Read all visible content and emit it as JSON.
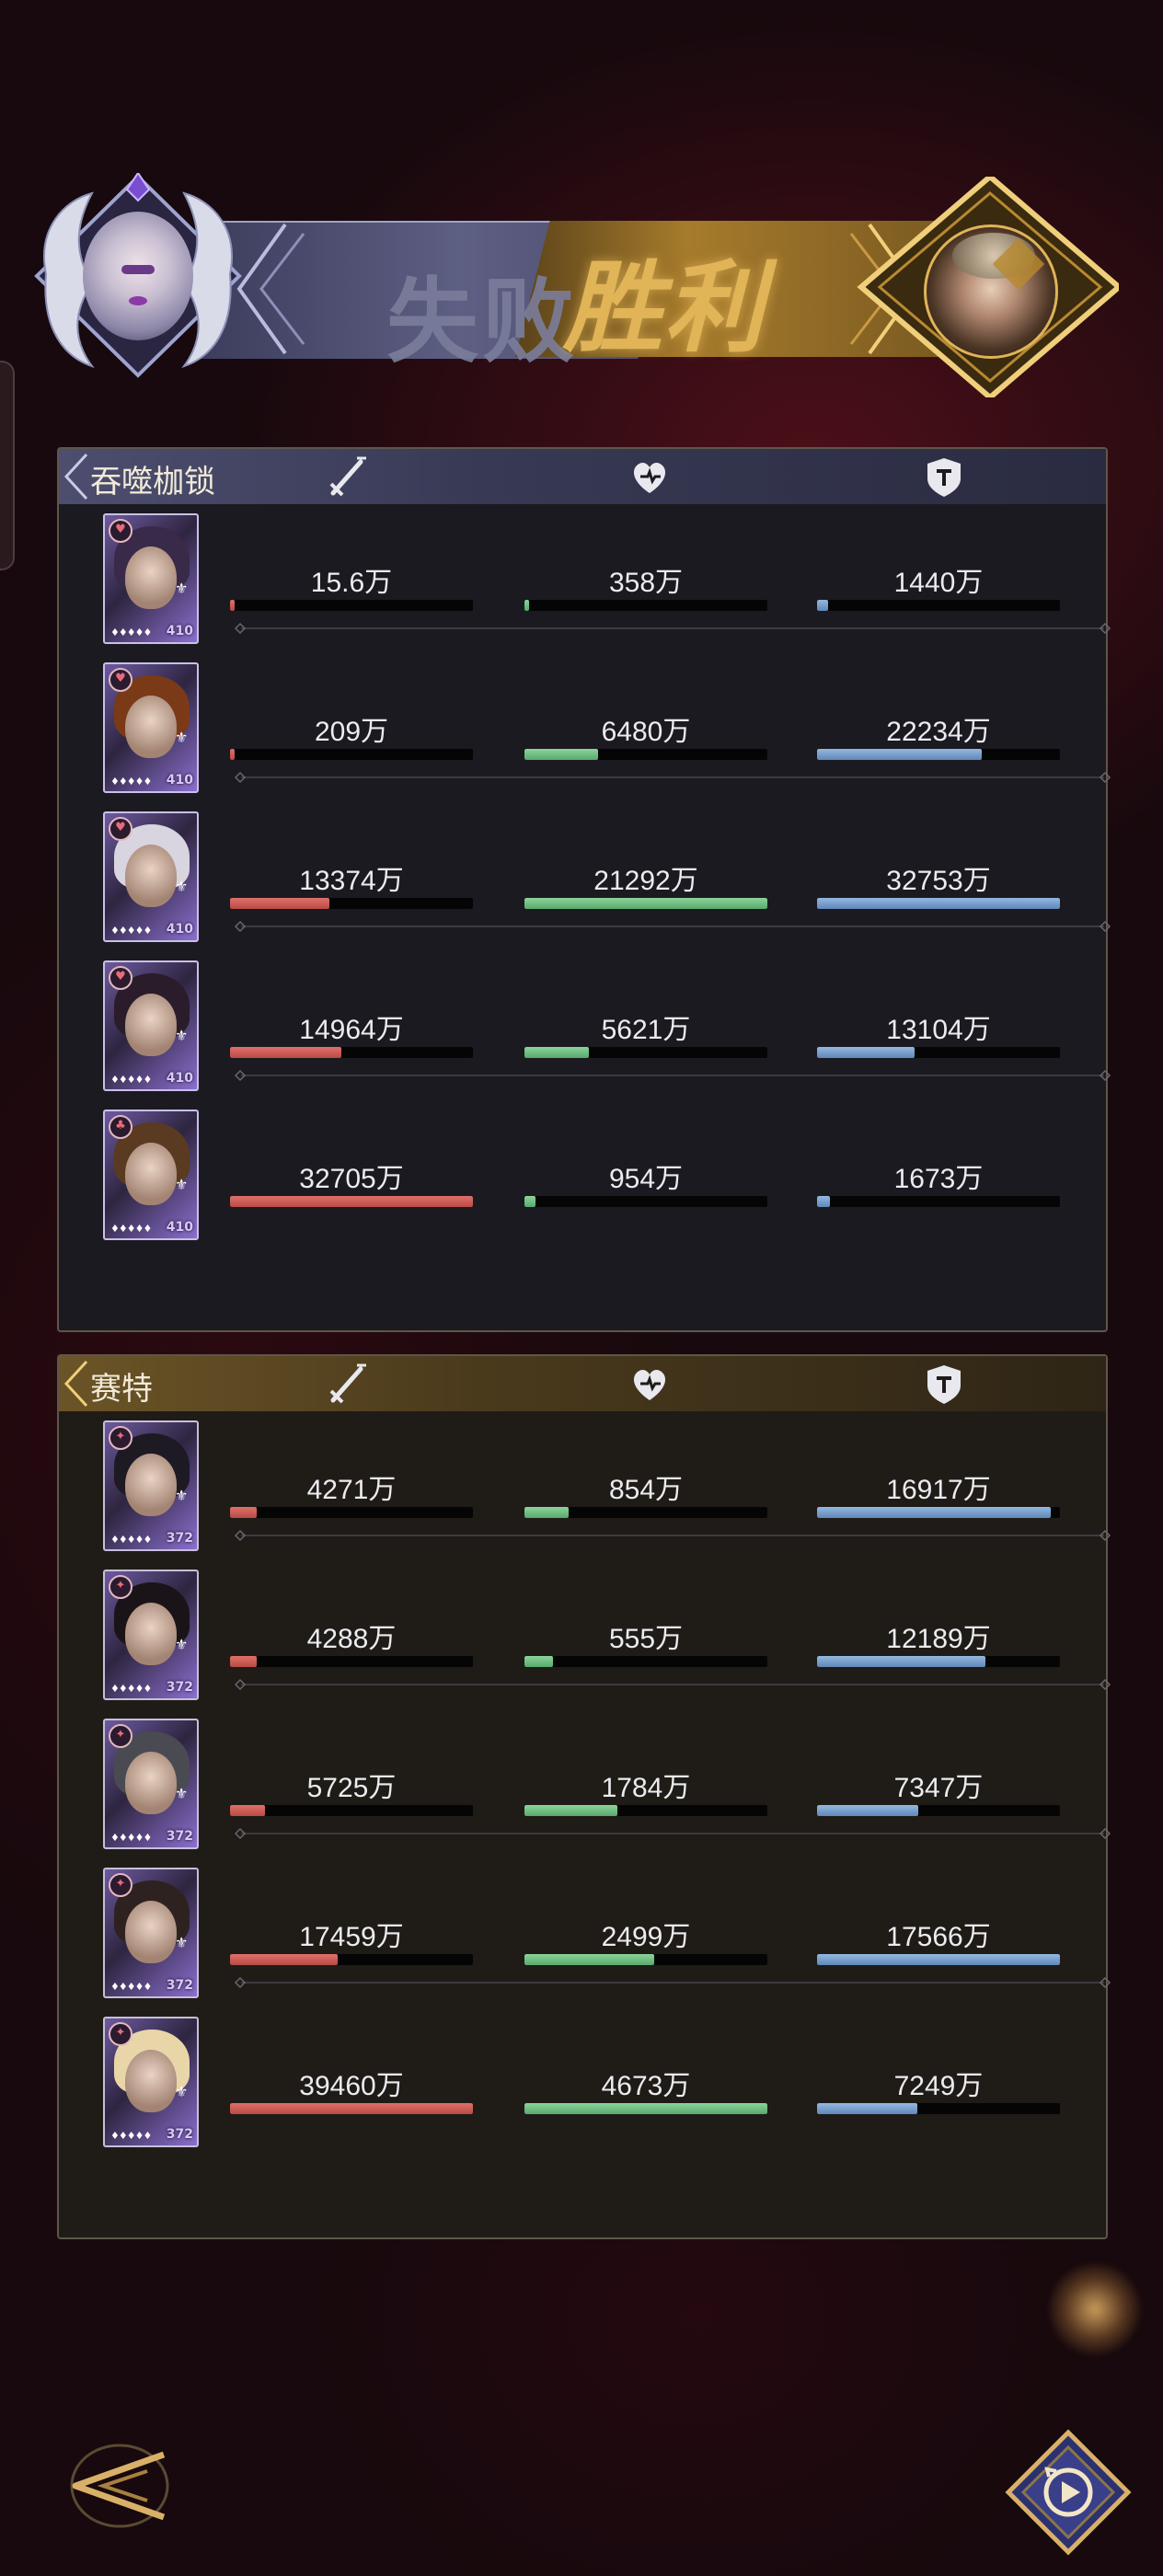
{
  "battle": {
    "lose_label": "失败",
    "win_label": "胜利",
    "left_avatar_icon": "white-haired-woman-avatar",
    "right_avatar_icon": "gold-masked-man-avatar"
  },
  "stat_icons": {
    "attack": "sword-icon",
    "heal": "heart-icon",
    "defense": "shield-icon"
  },
  "colors": {
    "attack_bar": "#c9534d",
    "heal_bar": "#6fbd7f",
    "defense_bar": "#7aa2d0",
    "win_gold": "#e0b457",
    "lose_slate": "#7b7d9b"
  },
  "teams": [
    {
      "name": "吞噬枷锁",
      "result": "lose",
      "heroes": [
        {
          "level": "410",
          "badge": "heart",
          "attack": "15.6万",
          "heal": "358万",
          "defense": "1440万",
          "attack_pct": 0.005,
          "heal_pct": 0.017,
          "defense_pct": 0.044
        },
        {
          "level": "410",
          "badge": "heart",
          "attack": "209万",
          "heal": "6480万",
          "defense": "22234万",
          "attack_pct": 0.006,
          "heal_pct": 0.304,
          "defense_pct": 0.679
        },
        {
          "level": "410",
          "badge": "heart",
          "attack": "13374万",
          "heal": "21292万",
          "defense": "32753万",
          "attack_pct": 0.409,
          "heal_pct": 1.0,
          "defense_pct": 1.0
        },
        {
          "level": "410",
          "badge": "heart",
          "attack": "14964万",
          "heal": "5621万",
          "defense": "13104万",
          "attack_pct": 0.458,
          "heal_pct": 0.264,
          "defense_pct": 0.4
        },
        {
          "level": "410",
          "badge": "clover",
          "attack": "32705万",
          "heal": "954万",
          "defense": "1673万",
          "attack_pct": 1.0,
          "heal_pct": 0.045,
          "defense_pct": 0.051
        }
      ]
    },
    {
      "name": "赛特",
      "result": "win",
      "heroes": [
        {
          "level": "372",
          "badge": "star",
          "attack": "4271万",
          "heal": "854万",
          "defense": "16917万",
          "attack_pct": 0.108,
          "heal_pct": 0.183,
          "defense_pct": 0.963
        },
        {
          "level": "372",
          "badge": "star",
          "attack": "4288万",
          "heal": "555万",
          "defense": "12189万",
          "attack_pct": 0.109,
          "heal_pct": 0.119,
          "defense_pct": 0.694
        },
        {
          "level": "372",
          "badge": "star",
          "attack": "5725万",
          "heal": "1784万",
          "defense": "7347万",
          "attack_pct": 0.145,
          "heal_pct": 0.382,
          "defense_pct": 0.418
        },
        {
          "level": "372",
          "badge": "star",
          "attack": "17459万",
          "heal": "2499万",
          "defense": "17566万",
          "attack_pct": 0.442,
          "heal_pct": 0.535,
          "defense_pct": 1.0
        },
        {
          "level": "372",
          "badge": "star",
          "attack": "39460万",
          "heal": "4673万",
          "defense": "7249万",
          "attack_pct": 1.0,
          "heal_pct": 1.0,
          "defense_pct": 0.413
        }
      ]
    }
  ],
  "controls": {
    "back_icon": "back-arrow-icon",
    "replay_icon": "replay-icon"
  }
}
